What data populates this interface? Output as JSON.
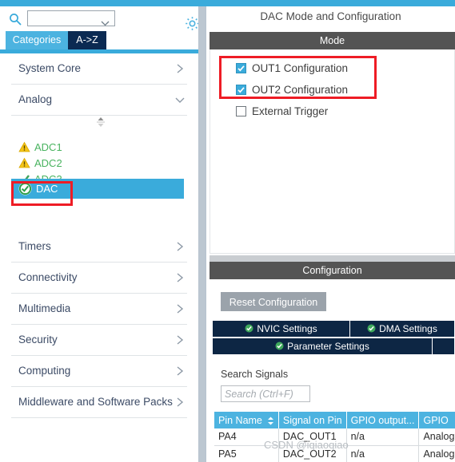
{
  "theme": {
    "accent_blue": "#3aabdb",
    "tab_navy": "#0b2a52",
    "header_gray": "#545454",
    "highlight_red": "#ee1c25",
    "ok_green": "#2e9e4b",
    "warn_yellow": "#f3c21b"
  },
  "left_panel": {
    "search": {
      "placeholder": "",
      "value": "",
      "icon": "search-icon"
    },
    "gear_icon": "gear-icon",
    "tabs": [
      {
        "label": "Categories",
        "selected": true
      },
      {
        "label": "A->Z",
        "selected": false
      }
    ],
    "categories": [
      {
        "label": "System Core",
        "expanded": false,
        "chevron": "chevron-right-icon"
      },
      {
        "label": "Analog",
        "expanded": true,
        "chevron": "chevron-down-icon"
      },
      {
        "label": "Timers",
        "expanded": false,
        "chevron": "chevron-right-icon"
      },
      {
        "label": "Connectivity",
        "expanded": false,
        "chevron": "chevron-right-icon"
      },
      {
        "label": "Multimedia",
        "expanded": false,
        "chevron": "chevron-right-icon"
      },
      {
        "label": "Security",
        "expanded": false,
        "chevron": "chevron-right-icon"
      },
      {
        "label": "Computing",
        "expanded": false,
        "chevron": "chevron-right-icon"
      },
      {
        "label": "Middleware and Software Packs",
        "expanded": false,
        "chevron": "chevron-right-icon"
      }
    ],
    "analog_items": [
      {
        "label": "ADC1",
        "status": "warning",
        "icon": "warning-triangle-icon",
        "selected": false
      },
      {
        "label": "ADC2",
        "status": "warning",
        "icon": "warning-triangle-icon",
        "selected": false
      },
      {
        "label": "ADC3",
        "status": "ok",
        "icon": "check-icon",
        "selected": false
      },
      {
        "label": "DAC",
        "status": "ok",
        "icon": "check-circle-icon",
        "selected": true
      }
    ],
    "scroll_spinner": "scroll-spinner-icon"
  },
  "right_panel": {
    "title": "DAC Mode and Configuration",
    "mode": {
      "header": "Mode",
      "checkboxes": [
        {
          "label": "OUT1 Configuration",
          "checked": true
        },
        {
          "label": "OUT2 Configuration",
          "checked": true
        },
        {
          "label": "External Trigger",
          "checked": false
        }
      ]
    },
    "configuration": {
      "header": "Configuration",
      "reset_button": "Reset Configuration",
      "tabs": [
        {
          "label": "NVIC Settings",
          "status_icon": "ok-check-icon"
        },
        {
          "label": "DMA Settings",
          "status_icon": "ok-check-icon"
        },
        {
          "label": "Parameter Settings",
          "status_icon": "ok-check-icon"
        }
      ],
      "search_signals_label": "Search Signals",
      "search_signals_placeholder": "Search (Ctrl+F)",
      "search_signals_value": "",
      "table": {
        "columns": [
          "Pin Name",
          "Signal on Pin",
          "GPIO output...",
          "GPIO"
        ],
        "sort_column": "Pin Name",
        "sort_icon": "sort-arrows-icon",
        "rows": [
          [
            "PA4",
            "DAC_OUT1",
            "n/a",
            "Analog"
          ],
          [
            "PA5",
            "DAC_OUT2",
            "n/a",
            "Analog"
          ]
        ]
      }
    }
  },
  "watermark": "CSDN @iqiaoqiao"
}
